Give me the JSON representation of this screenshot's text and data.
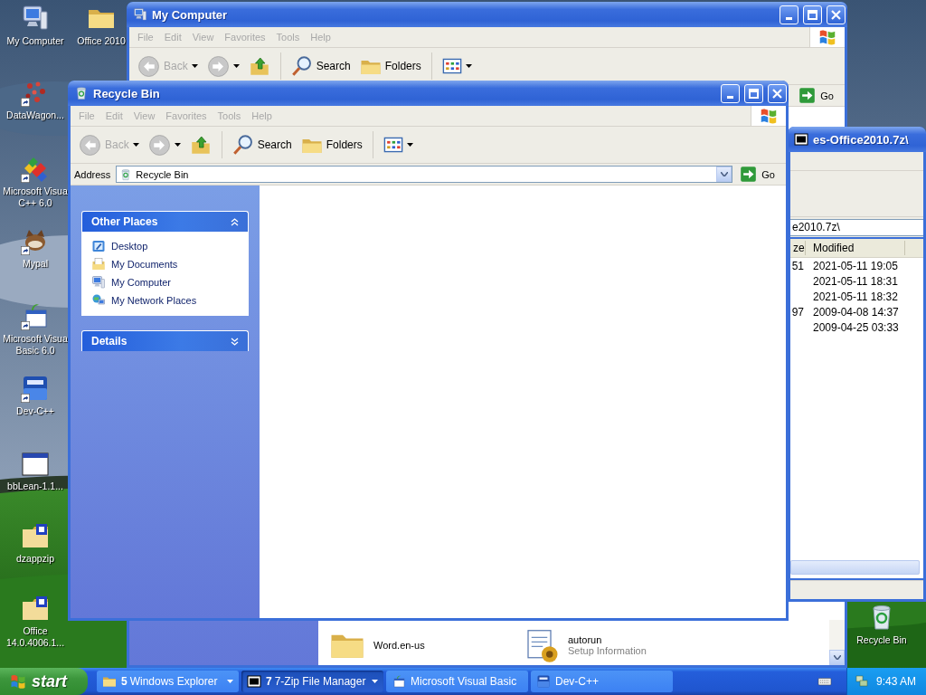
{
  "desktop": {
    "icons": [
      {
        "lines": [
          "My Computer"
        ],
        "kind": "computer",
        "shortcut": false
      },
      {
        "lines": [
          "Office 2010"
        ],
        "kind": "folder",
        "shortcut": false
      },
      {
        "lines": [
          "DataWagon..."
        ],
        "kind": "dots",
        "shortcut": true
      },
      {
        "lines": [
          "Microsoft Visua",
          "C++ 6.0"
        ],
        "kind": "blocks",
        "shortcut": true
      },
      {
        "lines": [
          "Mypal"
        ],
        "kind": "animal",
        "shortcut": true
      },
      {
        "lines": [
          "Microsoft Visua",
          "Basic 6.0"
        ],
        "kind": "vb",
        "shortcut": true
      },
      {
        "lines": [
          "Dev-C++"
        ],
        "kind": "dev",
        "shortcut": true
      },
      {
        "lines": [
          "bbLean-1.1..."
        ],
        "kind": "window",
        "shortcut": false
      },
      {
        "lines": [
          "dzappzip"
        ],
        "kind": "zipfolder",
        "shortcut": false
      },
      {
        "lines": [
          "Office",
          "14.0.4006.1..."
        ],
        "kind": "zipfolder",
        "shortcut": false
      },
      {
        "lines": [
          "Recycle Bin"
        ],
        "kind": "recycle",
        "shortcut": false
      }
    ]
  },
  "windows": [
    {
      "kind": "computer",
      "title": "My Computer",
      "menu": [
        {
          "label": "File",
          "disabled": true
        },
        {
          "label": "Edit",
          "disabled": true
        },
        {
          "label": "View",
          "disabled": true
        },
        {
          "label": "Favorites",
          "disabled": true
        },
        {
          "label": "Tools",
          "disabled": true
        },
        {
          "label": "Help",
          "disabled": true
        }
      ],
      "toolbar": {
        "back": "Back",
        "search": "Search",
        "folders": "Folders"
      },
      "address": {
        "go": "Go"
      },
      "files": [
        {
          "name": "Word.en-us",
          "kind": "folder"
        },
        {
          "name": "autorun",
          "type": "Setup Information",
          "kind": "setup"
        }
      ]
    },
    {
      "kind": "archive",
      "title": "es-Office2010.7z\\",
      "address": "e2010.7z\\",
      "columns": [
        "ze",
        "Modified"
      ],
      "rows": [
        {
          "size": "51",
          "modified": "2021-05-11 19:05"
        },
        {
          "modified": "2021-05-11 18:31"
        },
        {
          "modified": "2021-05-11 18:32"
        },
        {
          "size": "97",
          "modified": "2009-04-08 14:37"
        },
        {
          "modified": "2009-04-25 03:33"
        }
      ]
    },
    {
      "kind": "recycle",
      "title": "Recycle Bin",
      "menu": [
        {
          "label": "File",
          "disabled": true
        },
        {
          "label": "Edit",
          "disabled": true
        },
        {
          "label": "View",
          "disabled": true
        },
        {
          "label": "Favorites",
          "disabled": true
        },
        {
          "label": "Tools",
          "disabled": true
        },
        {
          "label": "Help",
          "disabled": true
        }
      ],
      "toolbar": {
        "back": "Back",
        "search": "Search",
        "folders": "Folders"
      },
      "address": {
        "label": "Address",
        "value": "Recycle Bin",
        "go": "Go"
      },
      "task_pane": [
        {
          "title": "Other Places",
          "expanded": true,
          "items": [
            {
              "label": "Desktop",
              "kind": "desktop"
            },
            {
              "label": "My Documents",
              "kind": "documents"
            },
            {
              "label": "My Computer",
              "kind": "computer"
            },
            {
              "label": "My Network Places",
              "kind": "network"
            }
          ]
        },
        {
          "title": "Details",
          "expanded": false
        }
      ]
    }
  ],
  "taskbar": {
    "start": "start",
    "buttons": [
      {
        "count": "5",
        "label": "Windows Explorer",
        "kind": "folder",
        "grouped": true,
        "selected": false
      },
      {
        "count": "7",
        "label": "7-Zip File Manager",
        "kind": "zip",
        "grouped": true,
        "selected": true
      },
      {
        "label": "Microsoft Visual Basic",
        "kind": "vb",
        "grouped": false,
        "selected": false
      },
      {
        "label": "Dev-C++",
        "kind": "dev",
        "grouped": false,
        "selected": false
      }
    ],
    "clock": "9:43 AM"
  }
}
